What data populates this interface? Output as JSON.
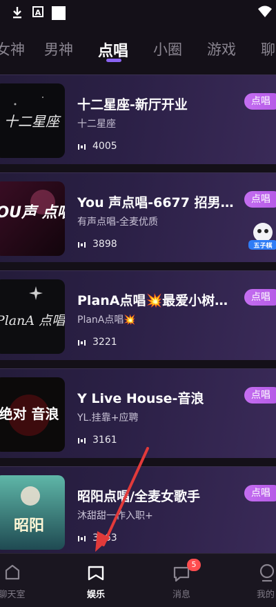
{
  "tabs": [
    "女神",
    "男神",
    "点唱",
    "小圈",
    "游戏",
    "聊"
  ],
  "rooms": [
    {
      "title": "十二星座-新厅开业",
      "subtitle": "十二星座",
      "count": "4005",
      "badge": "点唱",
      "thumb_text": "十二星座"
    },
    {
      "title": "You 声点唱-6677 招男…",
      "subtitle": "有声点唱-全麦优质",
      "count": "3898",
      "badge": "点唱",
      "thumb_text": "YOU声 点唱"
    },
    {
      "title": "PlanA点唱💥最爱小树…",
      "subtitle": "PlanA点唱💥",
      "count": "3221",
      "badge": "点唱",
      "thumb_text": "PlanA 点唱"
    },
    {
      "title": "Y Live House-音浪",
      "subtitle": "YL.挂靠+应聘",
      "count": "3161",
      "badge": "点唱",
      "thumb_text": "绝对 音浪"
    },
    {
      "title": "昭阳点唱/全麦女歌手",
      "subtitle": "沐甜甜一作入职+",
      "count": "3163",
      "badge": "点唱",
      "thumb_text": "昭阳"
    }
  ],
  "mascot_label": "五子棋",
  "nav": [
    {
      "label": "聊天室",
      "icon": "room-icon"
    },
    {
      "label": "娱乐",
      "icon": "entertainment-icon"
    },
    {
      "label": "消息",
      "icon": "message-icon",
      "badge": "5"
    },
    {
      "label": "我的",
      "icon": "profile-icon"
    }
  ],
  "colors": {
    "background": "#141018",
    "card": "#2b2046",
    "badge": "#c46ef0",
    "tab_indicator": "#8a63f2",
    "annotation_arrow": "#e23a3a"
  }
}
